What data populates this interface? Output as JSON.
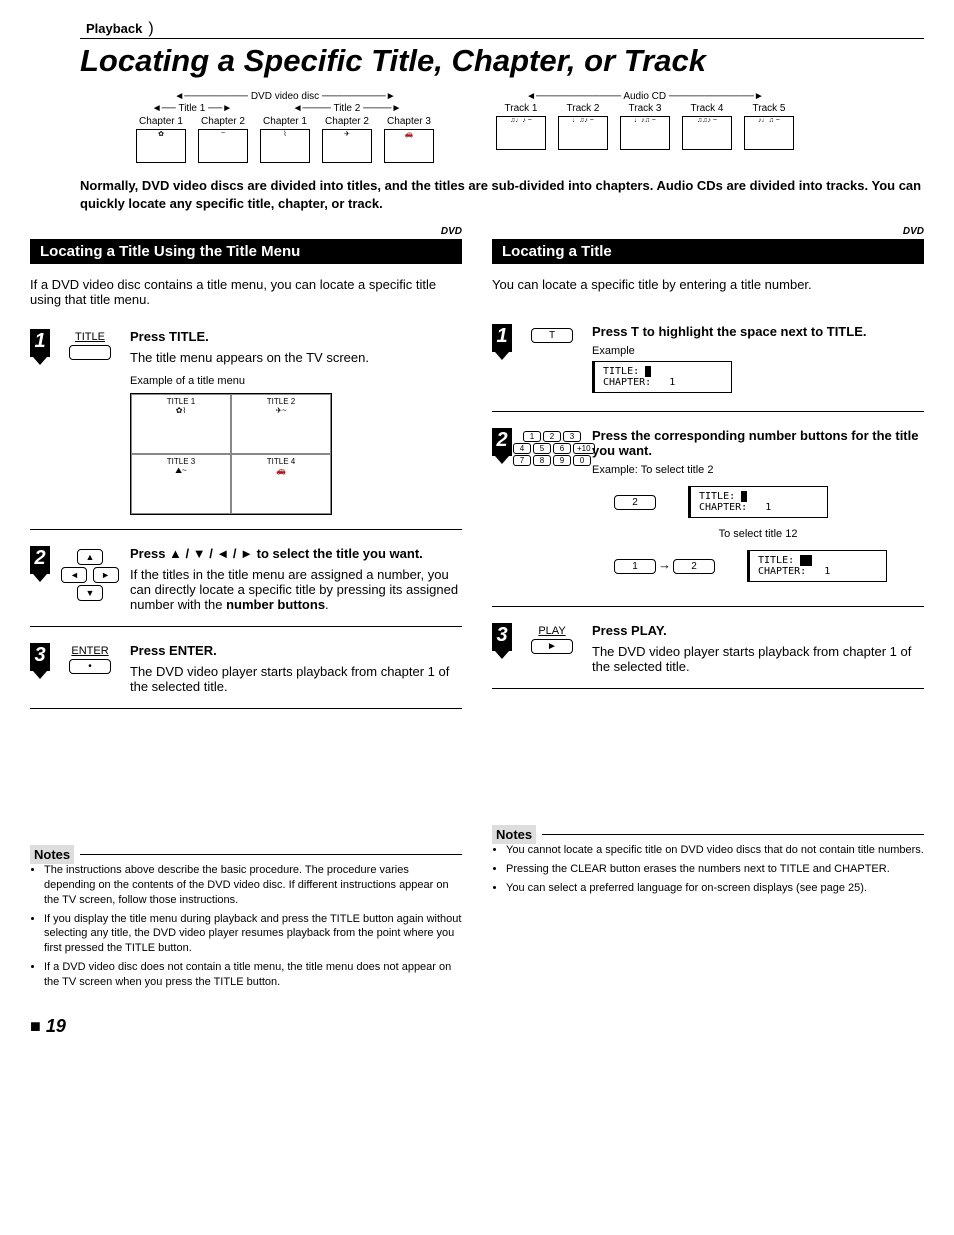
{
  "playback_tab": "Playback",
  "page_title": "Locating a Specific Title, Chapter, or Track",
  "dvd_diagram": {
    "top": "DVD video disc",
    "titles": [
      "Title 1",
      "Title 2"
    ],
    "chapters": [
      "Chapter 1",
      "Chapter 2",
      "Chapter 1",
      "Chapter 2",
      "Chapter 3"
    ]
  },
  "cd_diagram": {
    "top": "Audio CD",
    "tracks": [
      "Track 1",
      "Track 2",
      "Track 3",
      "Track 4",
      "Track 5"
    ]
  },
  "intro": "Normally, DVD video discs are divided into titles, and the titles are sub-divided into chapters. Audio CDs are divided into tracks. You can quickly locate any specific title, chapter, or track.",
  "dvd_tag": "DVD",
  "left": {
    "header": "Locating a Title Using the Title Menu",
    "intro": "If a DVD video disc contains a title menu, you can locate a specific title using that title menu.",
    "step1": {
      "icon_label": "TITLE",
      "lead": "Press TITLE.",
      "body": "The title menu appears on the TV screen.",
      "example_label": "Example of a title menu",
      "thumbs": [
        "TITLE 1",
        "TITLE 2",
        "TITLE 3",
        "TITLE 4"
      ]
    },
    "step2": {
      "lead": "Press ▲ / ▼ / ◄ / ► to select the title you want.",
      "body1": "If the titles in the title menu are assigned a number, you can directly locate a specific title by pressing its assigned number with the ",
      "body1_bold": "number buttons",
      "body1_end": "."
    },
    "step3": {
      "icon_label": "ENTER",
      "lead": "Press ENTER.",
      "body": "The DVD video player starts playback from chapter 1 of the selected title."
    },
    "notes_label": "Notes",
    "notes": [
      "The instructions above describe the basic procedure. The procedure varies depending on the contents of the DVD video disc. If different instructions appear on the TV screen, follow those instructions.",
      "If you display the title menu during playback and press the TITLE button again without selecting any title, the DVD video player resumes playback from the point where you first pressed the TITLE button.",
      "If a DVD video disc does not contain a title menu, the title menu does not appear on the TV screen when you press the TITLE button."
    ]
  },
  "right": {
    "header": "Locating a Title",
    "intro": "You can locate a specific title by entering a title number.",
    "step1": {
      "icon_label": "T",
      "lead": "Press T to highlight the space next to TITLE.",
      "example_label": "Example",
      "display": "TITLE: ■\nCHAPTER:   1"
    },
    "step2": {
      "lead": "Press the corresponding number buttons for the title you want.",
      "example_label": "Example: To select title 2",
      "btn2": "2",
      "display2": "TITLE: ■\nCHAPTER:   1",
      "mid_label": "To select title 12",
      "btn1": "1",
      "display12": "TITLE: ■\nCHAPTER:   1"
    },
    "step3": {
      "icon_label": "PLAY",
      "lead": "Press PLAY.",
      "body": "The DVD video player starts playback from chapter 1 of the selected title."
    },
    "notes_label": "Notes",
    "notes": [
      "You cannot locate a specific title on DVD video discs that do not contain title numbers.",
      "Pressing the CLEAR button erases the numbers next to TITLE and CHAPTER.",
      "You can select a preferred language for on-screen displays (see page 25)."
    ]
  },
  "page_number": "19"
}
